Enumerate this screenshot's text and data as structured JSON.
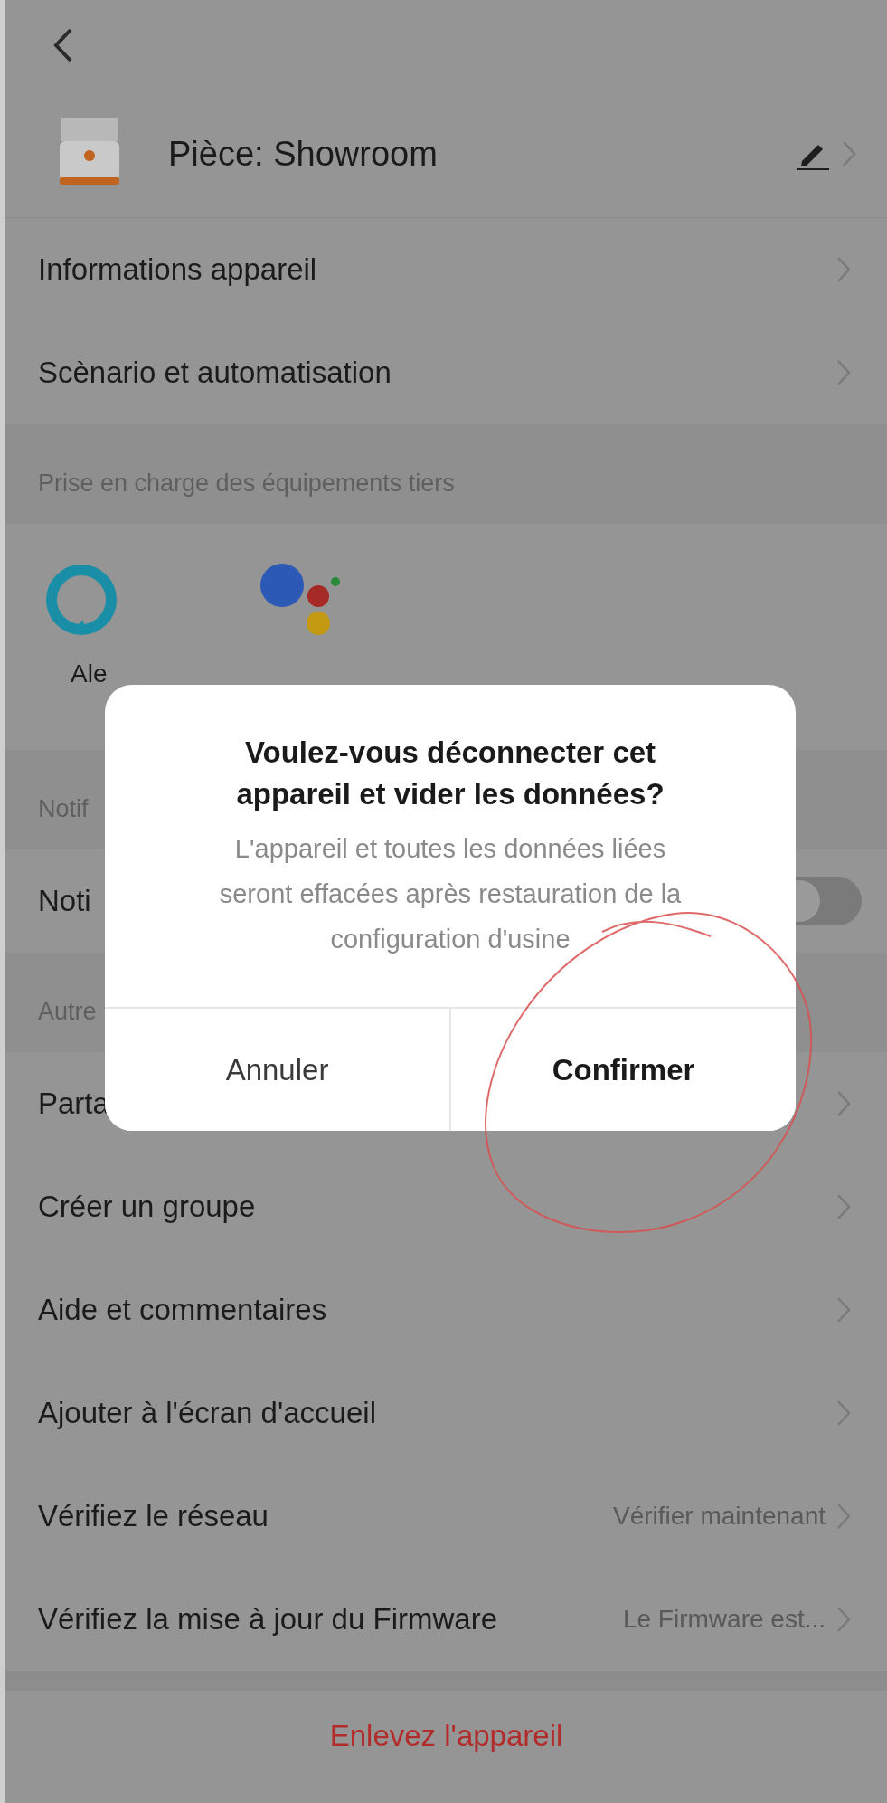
{
  "header": {
    "room": "Pièce: Showroom"
  },
  "menu_top": [
    {
      "label": "Informations appareil"
    },
    {
      "label": "Scènario et automatisation"
    }
  ],
  "third_party": {
    "heading": "Prise en charge des équipements tiers",
    "items": [
      {
        "kind": "ring",
        "label": "Ale"
      },
      {
        "kind": "dots"
      }
    ]
  },
  "notifications": {
    "heading": "Notif",
    "row": {
      "label": "Noti",
      "on": false
    }
  },
  "others": {
    "heading": "Autre",
    "items": [
      {
        "label": "Parta"
      },
      {
        "label": "Créer un groupe"
      },
      {
        "label": "Aide et commentaires"
      },
      {
        "label": "Ajouter à l'écran d'accueil"
      },
      {
        "label": "Vérifiez le réseau",
        "value": "Vérifier maintenant"
      },
      {
        "label": "Vérifiez la mise à jour du Firmware",
        "value": "Le Firmware est..."
      }
    ]
  },
  "remove_button": "Enlevez l'appareil",
  "dialog": {
    "title": "Voulez-vous déconnecter cet appareil et vider les données?",
    "message": "L'appareil et toutes les données liées seront effacées après restauration de la configuration d'usine",
    "buttons": [
      {
        "label": "Annuler",
        "primary": false
      },
      {
        "label": "Confirmer",
        "primary": true
      }
    ]
  }
}
